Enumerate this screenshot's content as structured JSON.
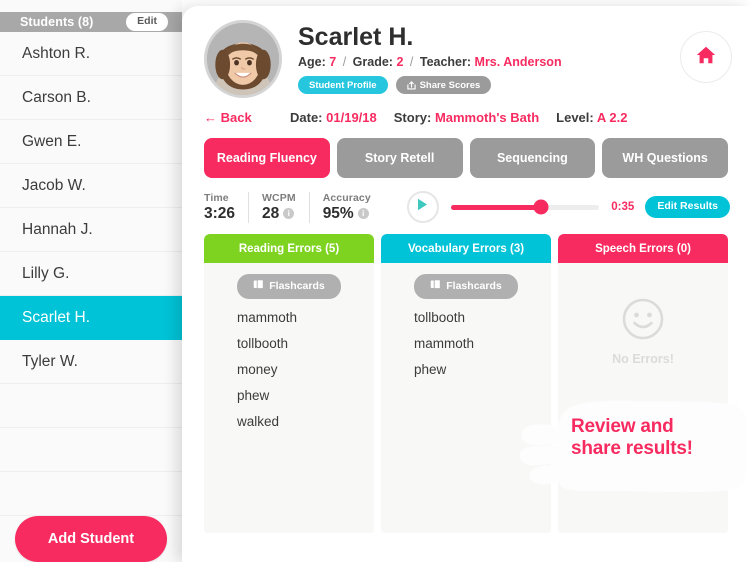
{
  "sidebar": {
    "header_title": "Students (8)",
    "edit_label": "Edit",
    "students": [
      {
        "name": "Ashton R.",
        "selected": false
      },
      {
        "name": "Carson B.",
        "selected": false
      },
      {
        "name": "Gwen E.",
        "selected": false
      },
      {
        "name": "Jacob W.",
        "selected": false
      },
      {
        "name": "Hannah J.",
        "selected": false
      },
      {
        "name": "Lilly G.",
        "selected": false
      },
      {
        "name": "Scarlet H.",
        "selected": true
      },
      {
        "name": "Tyler W.",
        "selected": false
      }
    ],
    "add_student_label": "Add Student"
  },
  "header": {
    "student_name": "Scarlet H.",
    "age_label": "Age:",
    "age_value": "7",
    "grade_label": "Grade:",
    "grade_value": "2",
    "teacher_label": "Teacher:",
    "teacher_value": "Mrs. Anderson",
    "profile_pill": "Student Profile",
    "share_pill": "Share Scores",
    "home_icon": "home-icon"
  },
  "subrow": {
    "back_label": "← Back",
    "date_label": "Date:",
    "date_value": "01/19/18",
    "story_label": "Story:",
    "story_value": "Mammoth's Bath",
    "level_label": "Level:",
    "level_value": "A 2.2"
  },
  "tabs": [
    {
      "label": "Reading Fluency",
      "active": true
    },
    {
      "label": "Story Retell",
      "active": false
    },
    {
      "label": "Sequencing",
      "active": false
    },
    {
      "label": "WH Questions",
      "active": false
    }
  ],
  "stats": [
    {
      "label": "Time",
      "value": "3:26",
      "info": false
    },
    {
      "label": "WCPM",
      "value": "28",
      "info": true
    },
    {
      "label": "Accuracy",
      "value": "95%",
      "info": true
    }
  ],
  "player": {
    "play_icon": "play-icon",
    "progress_percent": 61,
    "time_remaining": "0:35",
    "edit_results_label": "Edit Results"
  },
  "columns": [
    {
      "title": "Reading Errors (5)",
      "color": "#7ed321",
      "flashcards_label": "Flashcards",
      "has_flashcards": true,
      "words": [
        "mammoth",
        "tollbooth",
        "money",
        "phew",
        "walked"
      ],
      "empty_message": ""
    },
    {
      "title": "Vocabulary Errors (3)",
      "color": "#00c3d7",
      "flashcards_label": "Flashcards",
      "has_flashcards": true,
      "words": [
        "tollbooth",
        "mammoth",
        "phew"
      ],
      "empty_message": ""
    },
    {
      "title": "Speech Errors (0)",
      "color": "#f72b60",
      "flashcards_label": "",
      "has_flashcards": false,
      "words": [],
      "empty_message": "No Errors!"
    }
  ],
  "callout": {
    "line1": "Review and",
    "line2": "share results!"
  },
  "colors": {
    "pink": "#f72b60",
    "cyan": "#00c3d7",
    "green": "#7ed321",
    "grey": "#9b9b9b",
    "header_grey": "#a8a8a8"
  }
}
